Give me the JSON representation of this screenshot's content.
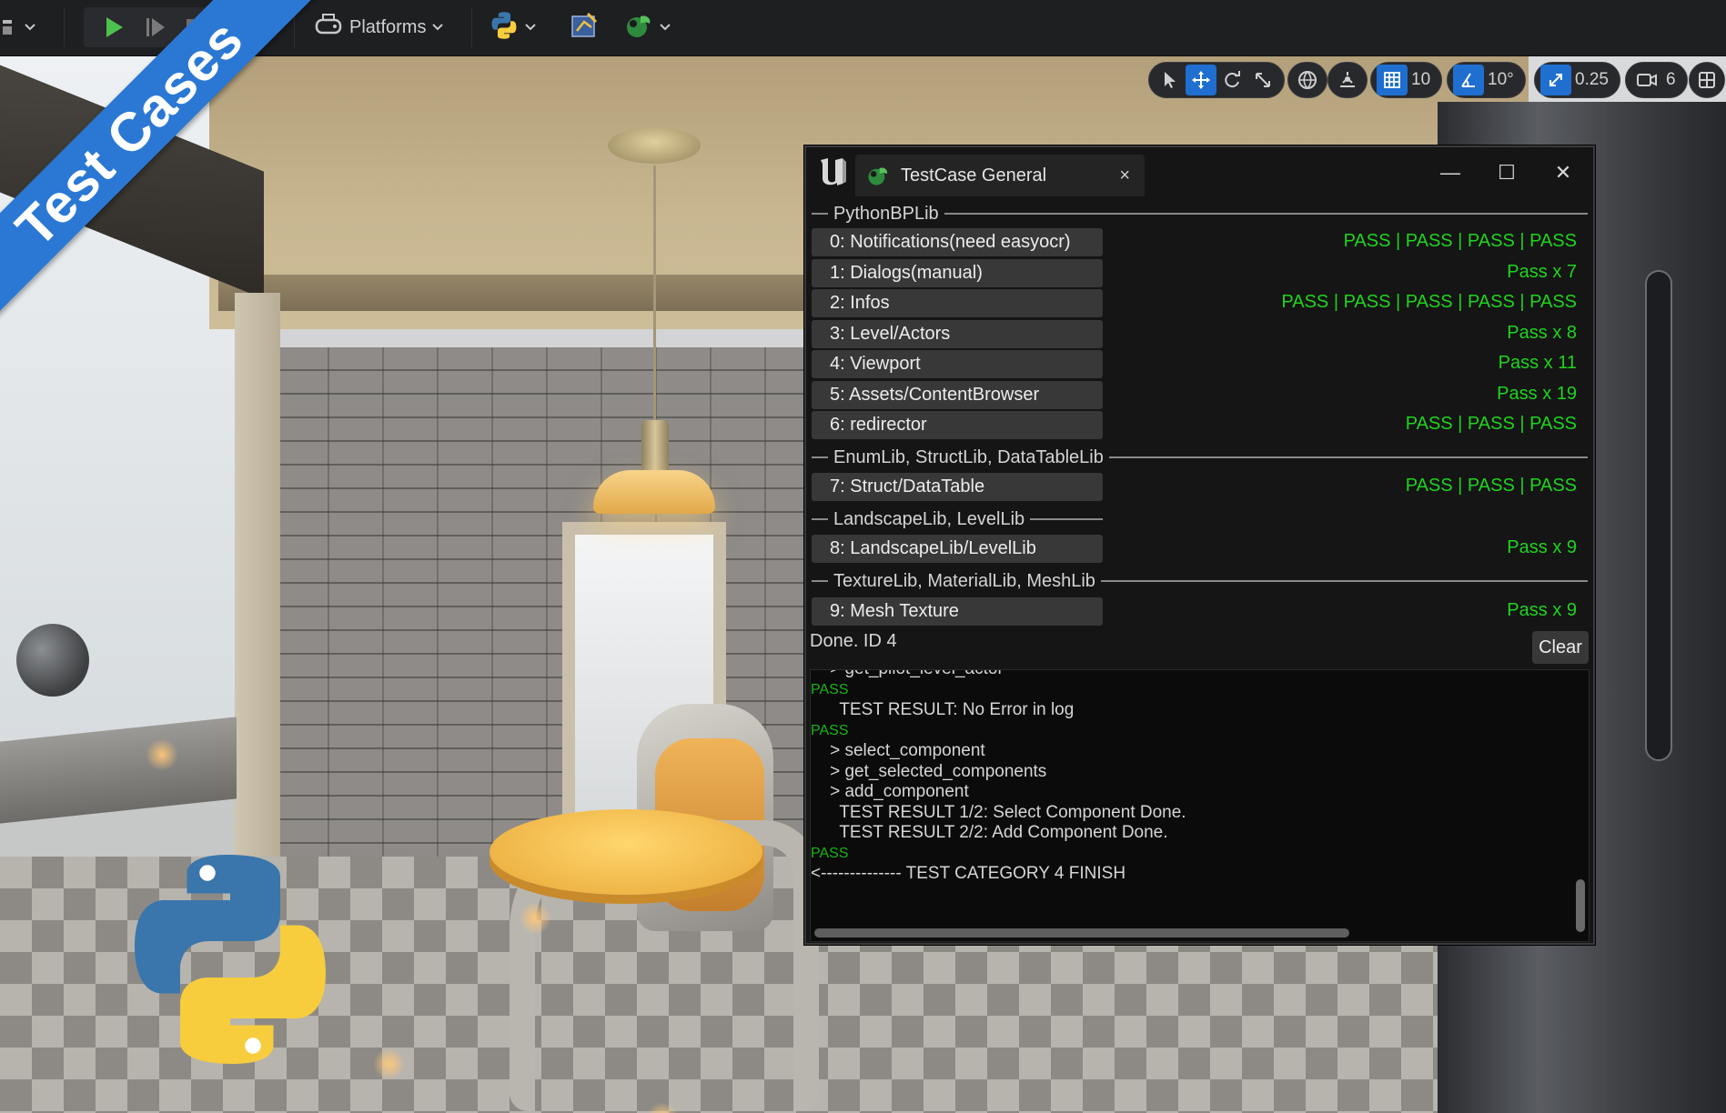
{
  "toolbar": {
    "platforms_label": "Platforms",
    "icons": [
      "menu-icon",
      "play-icon",
      "step-icon",
      "stop-icon",
      "platforms-icon",
      "python-icon",
      "blueprint-icon",
      "testcase-icon"
    ]
  },
  "ribbon": {
    "label": "Test Cases"
  },
  "viewport_tools": {
    "grid_snap_value": "10",
    "rotation_snap_value": "10°",
    "scale_snap_value": "0.25",
    "camera_speed_value": "6"
  },
  "window": {
    "tab_title": "TestCase General",
    "tab_close": "×",
    "minimize": "—",
    "maximize": "☐",
    "close": "✕",
    "sections": [
      {
        "label": "PythonBPLib",
        "items": [
          {
            "label": "0: Notifications(need easyocr)",
            "result": "PASS | PASS | PASS | PASS"
          },
          {
            "label": "1: Dialogs(manual)",
            "result": "Pass x 7"
          },
          {
            "label": "2: Infos",
            "result": "PASS | PASS | PASS | PASS | PASS"
          },
          {
            "label": "3: Level/Actors",
            "result": "Pass x 8"
          },
          {
            "label": "4: Viewport",
            "result": "Pass x 11"
          },
          {
            "label": "5: Assets/ContentBrowser",
            "result": "Pass x 19"
          },
          {
            "label": "6: redirector",
            "result": "PASS | PASS | PASS"
          }
        ]
      },
      {
        "label": "EnumLib, StructLib, DataTableLib",
        "items": [
          {
            "label": "7: Struct/DataTable",
            "result": "PASS | PASS | PASS"
          }
        ]
      },
      {
        "label": "LandscapeLib, LevelLib",
        "items": [
          {
            "label": "8: LandscapeLib/LevelLib",
            "result": "Pass x 9"
          }
        ]
      },
      {
        "label": "TextureLib, MaterialLib, MeshLib",
        "items": [
          {
            "label": "9: Mesh Texture",
            "result": "Pass x 9"
          }
        ]
      }
    ],
    "status": "Done. ID 4",
    "clear_label": "Clear",
    "log": [
      {
        "text": "    > get_pilot_level_actor",
        "pass": false
      },
      {
        "text": "PASS",
        "pass": true
      },
      {
        "text": "      TEST RESULT: No Error in log",
        "pass": false
      },
      {
        "text": "PASS",
        "pass": true
      },
      {
        "text": "    > select_component",
        "pass": false
      },
      {
        "text": "    > get_selected_components",
        "pass": false
      },
      {
        "text": "    > add_component",
        "pass": false
      },
      {
        "text": "      TEST RESULT 1/2: Select Component Done.",
        "pass": false
      },
      {
        "text": "      TEST RESULT 2/2: Add Component Done.",
        "pass": false
      },
      {
        "text": "PASS",
        "pass": true
      },
      {
        "text": "<-------------- TEST CATEGORY 4 FINISH",
        "pass": false
      }
    ]
  },
  "colors": {
    "pass_green": "#1fd41f",
    "ribbon_blue": "#2a78d4",
    "active_blue": "#1f6fd0"
  }
}
